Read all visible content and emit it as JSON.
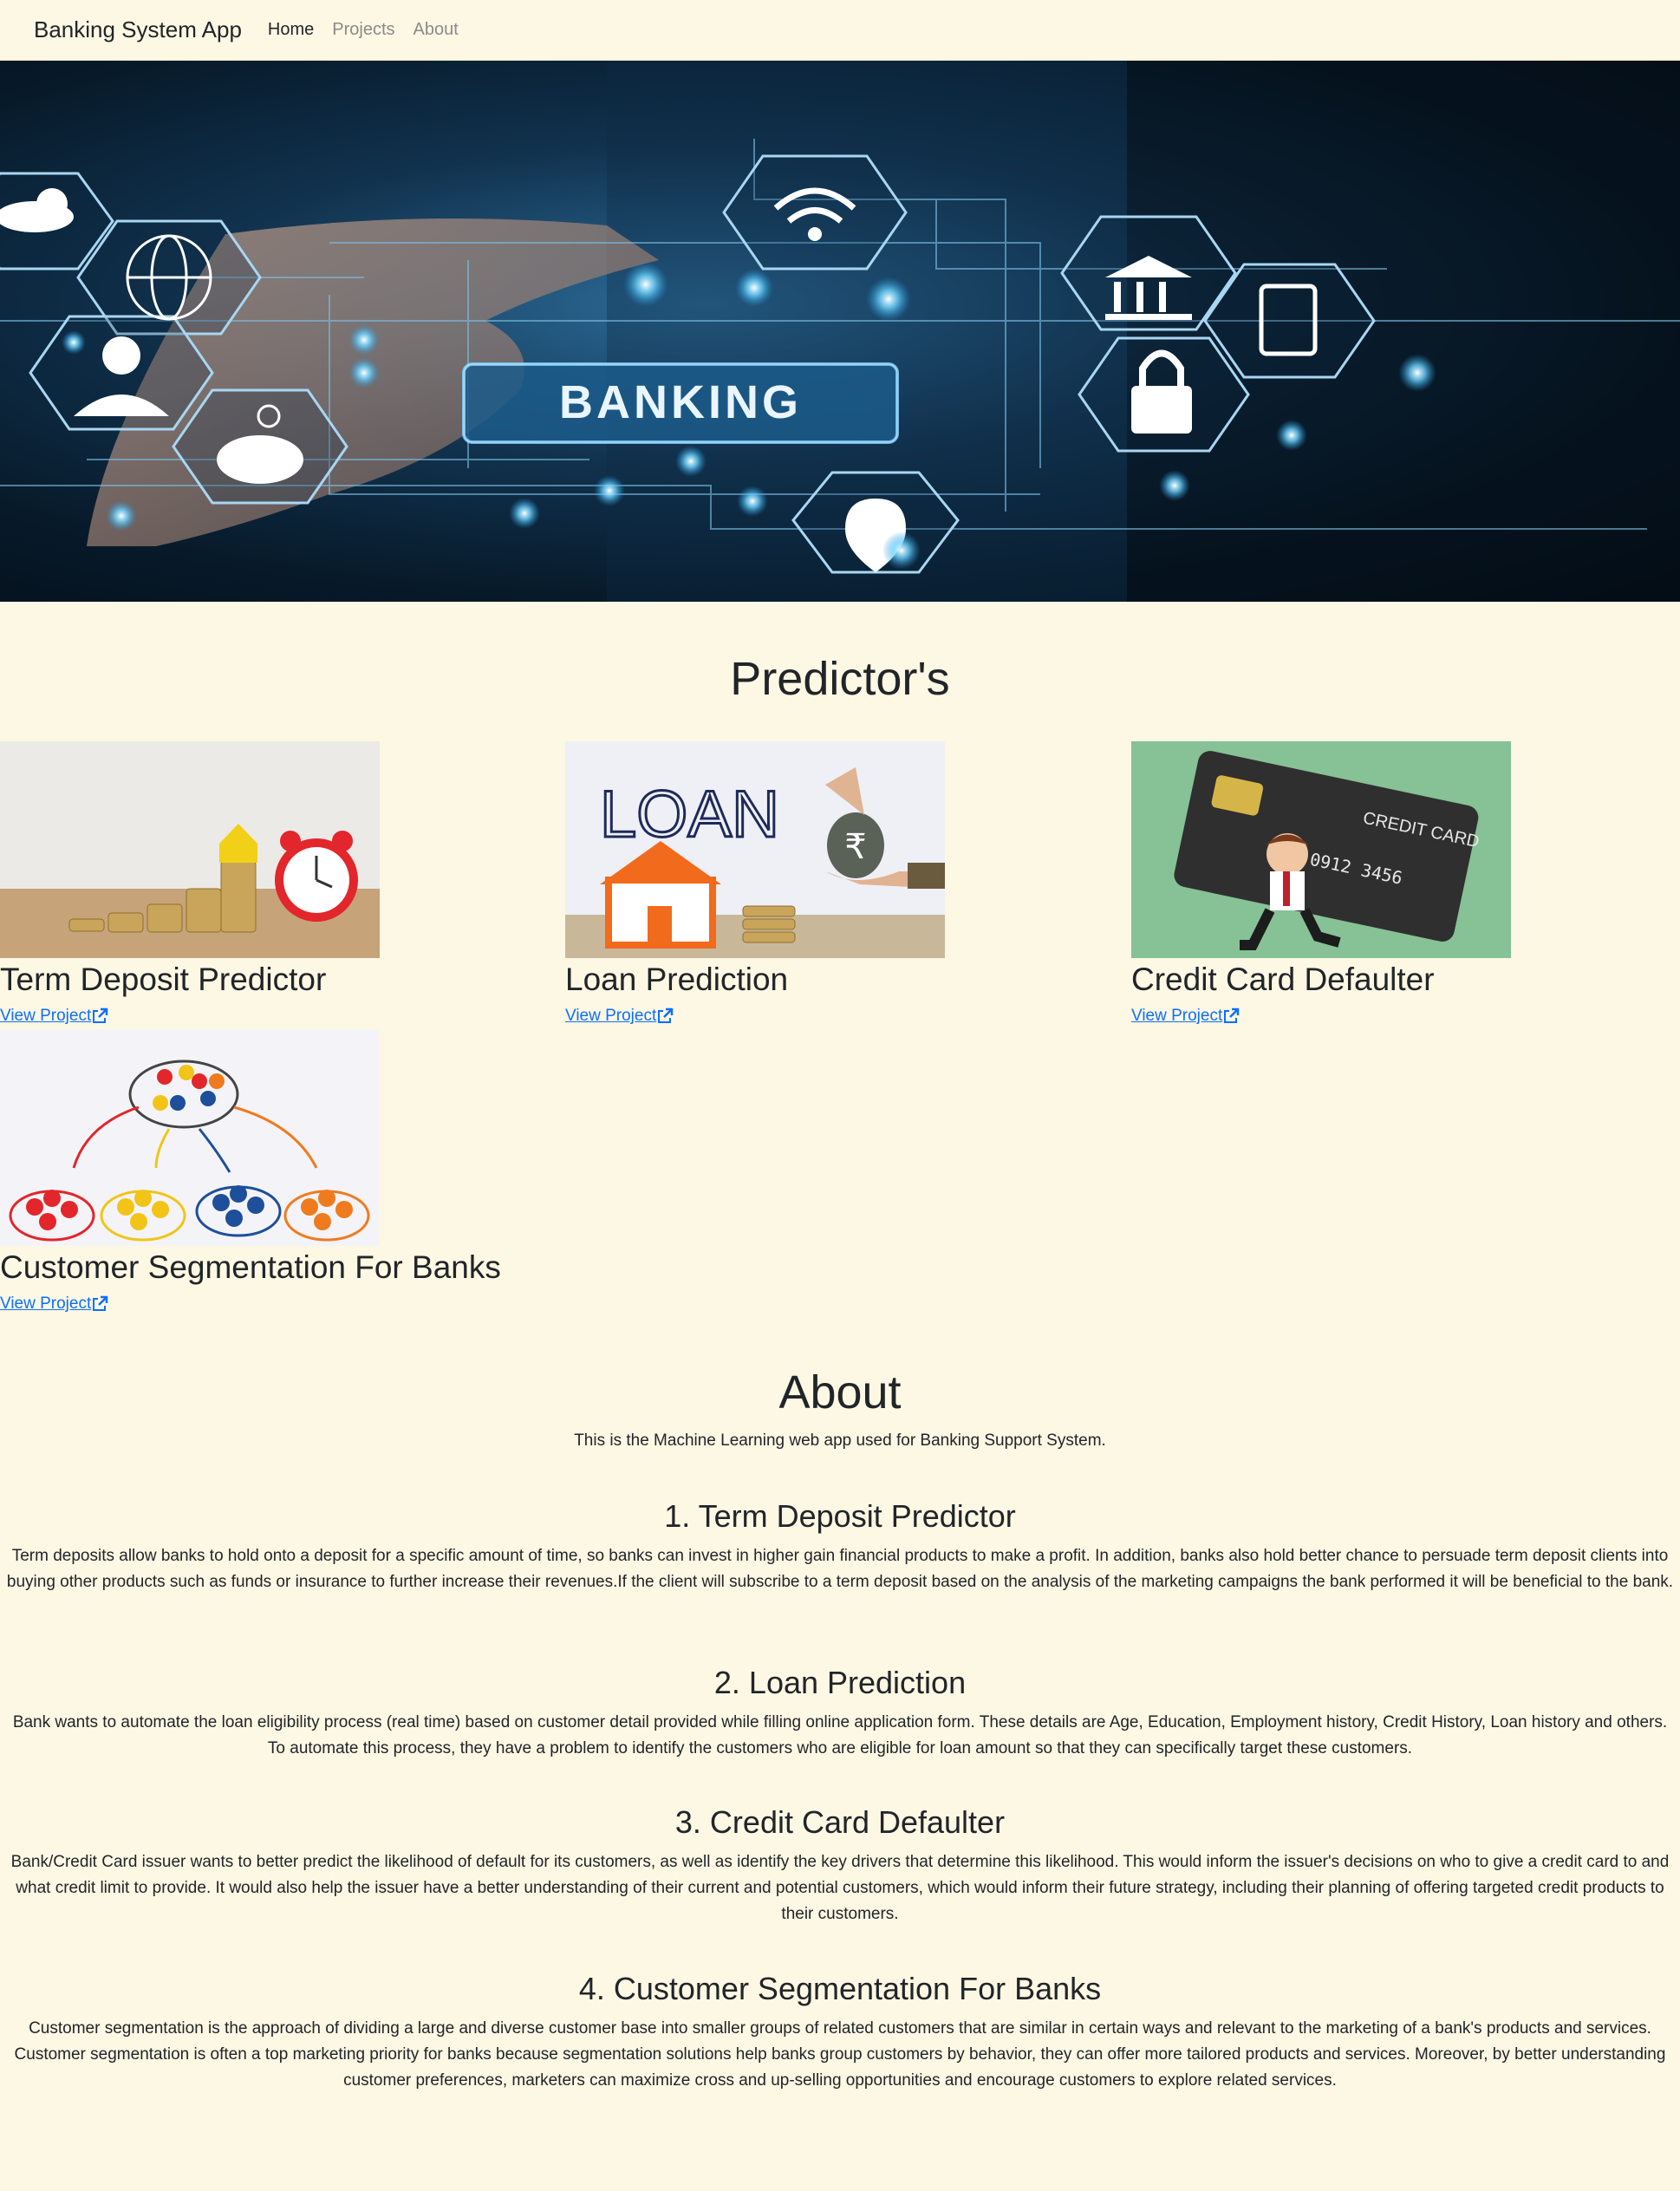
{
  "navbar": {
    "brand": "Banking System App",
    "links": [
      {
        "label": "Home",
        "active": true
      },
      {
        "label": "Projects",
        "active": false
      },
      {
        "label": "About",
        "active": false
      }
    ]
  },
  "hero": {
    "banner_text": "BANKING"
  },
  "predictors": {
    "title": "Predictor's",
    "cards": [
      {
        "title": "Term Deposit Predictor",
        "link_label": "View Project"
      },
      {
        "title": "Loan Prediction",
        "link_label": "View Project",
        "image_text": "LOAN"
      },
      {
        "title": "Credit Card Defaulter",
        "link_label": "View Project",
        "image_text": "CREDIT CARD"
      },
      {
        "title": "Customer Segmentation For Banks",
        "link_label": "View Project"
      }
    ]
  },
  "about": {
    "title": "About",
    "subtitle": "This is the Machine Learning web app used for Banking Support System.",
    "topics": [
      {
        "heading": "1. Term Deposit Predictor",
        "text": "Term deposits allow banks to hold onto a deposit for a specific amount of time, so banks can invest in higher gain financial products to make a profit. In addition, banks also hold better chance to persuade term deposit clients into buying other products such as funds or insurance to further increase their revenues.If the client will subscribe to a term deposit based on the analysis of the marketing campaigns the bank performed it will be beneficial to the bank."
      },
      {
        "heading": "2. Loan Prediction",
        "text": "Bank wants to automate the loan eligibility process (real time) based on customer detail provided while filling online application form. These details are Age, Education, Employment history, Credit History, Loan history and others. To automate this process, they have a problem to identify the customers who are eligible for loan amount so that they can specifically target these customers."
      },
      {
        "heading": "3. Credit Card Defaulter",
        "text": "Bank/Credit Card issuer wants to better predict the likelihood of default for its customers, as well as identify the key drivers that determine this likelihood. This would inform the issuer's decisions on who to give a credit card to and what credit limit to provide. It would also help the issuer have a better understanding of their current and potential customers, which would inform their future strategy, including their planning of offering targeted credit products to their customers."
      },
      {
        "heading": "4. Customer Segmentation For Banks",
        "text": "Customer segmentation is the approach of dividing a large and diverse customer base into smaller groups of related customers that are similar in certain ways and relevant to the marketing of a bank's products and services. Customer segmentation is often a top marketing priority for banks because segmentation solutions help banks group customers by behavior, they can offer more tailored products and services. Moreover, by better understanding customer preferences, marketers can maximize cross and up-selling opportunities and encourage customers to explore related services."
      }
    ]
  },
  "colors": {
    "page_bg": "#fdf8e4",
    "link": "#0d6efd",
    "text": "#212529",
    "nav_muted": "#8a8a8a"
  }
}
